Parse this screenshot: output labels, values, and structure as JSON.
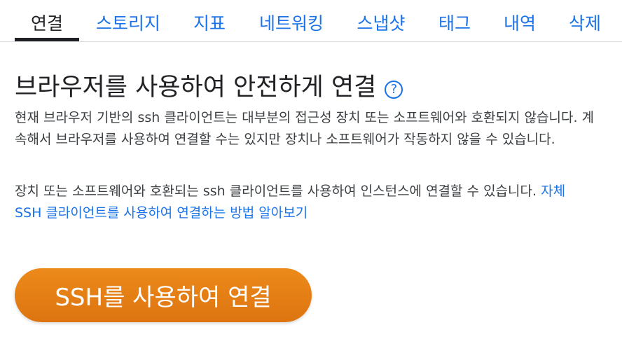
{
  "tabs": [
    {
      "label": "연결",
      "active": true
    },
    {
      "label": "스토리지",
      "active": false
    },
    {
      "label": "지표",
      "active": false
    },
    {
      "label": "네트워킹",
      "active": false
    },
    {
      "label": "스냅샷",
      "active": false
    },
    {
      "label": "태그",
      "active": false
    },
    {
      "label": "내역",
      "active": false
    },
    {
      "label": "삭제",
      "active": false
    }
  ],
  "main": {
    "title": "브라우저를 사용하여 안전하게 연결",
    "help_icon": "help-icon",
    "paragraph1": "현재 브라우저 기반의 ssh 클라이언트는 대부분의 접근성 장치 또는 소프트웨어와 호환되지 않습니다. 계속해서 브라우저를 사용하여 연결할 수는 있지만 장치나 소프트웨어가 작동하지 않을 수 있습니다.",
    "paragraph2": "장치 또는 소프트웨어와 호환되는 ssh 클라이언트를 사용하여 인스턴스에 연결할 수 있습니다.",
    "link": "자체 SSH 클라이언트를 사용하여 연결하는 방법 알아보기",
    "button": "SSH를 사용하여 연결"
  },
  "colors": {
    "accent": "#1a73e8",
    "button": "#e67e16",
    "text": "#202124"
  }
}
